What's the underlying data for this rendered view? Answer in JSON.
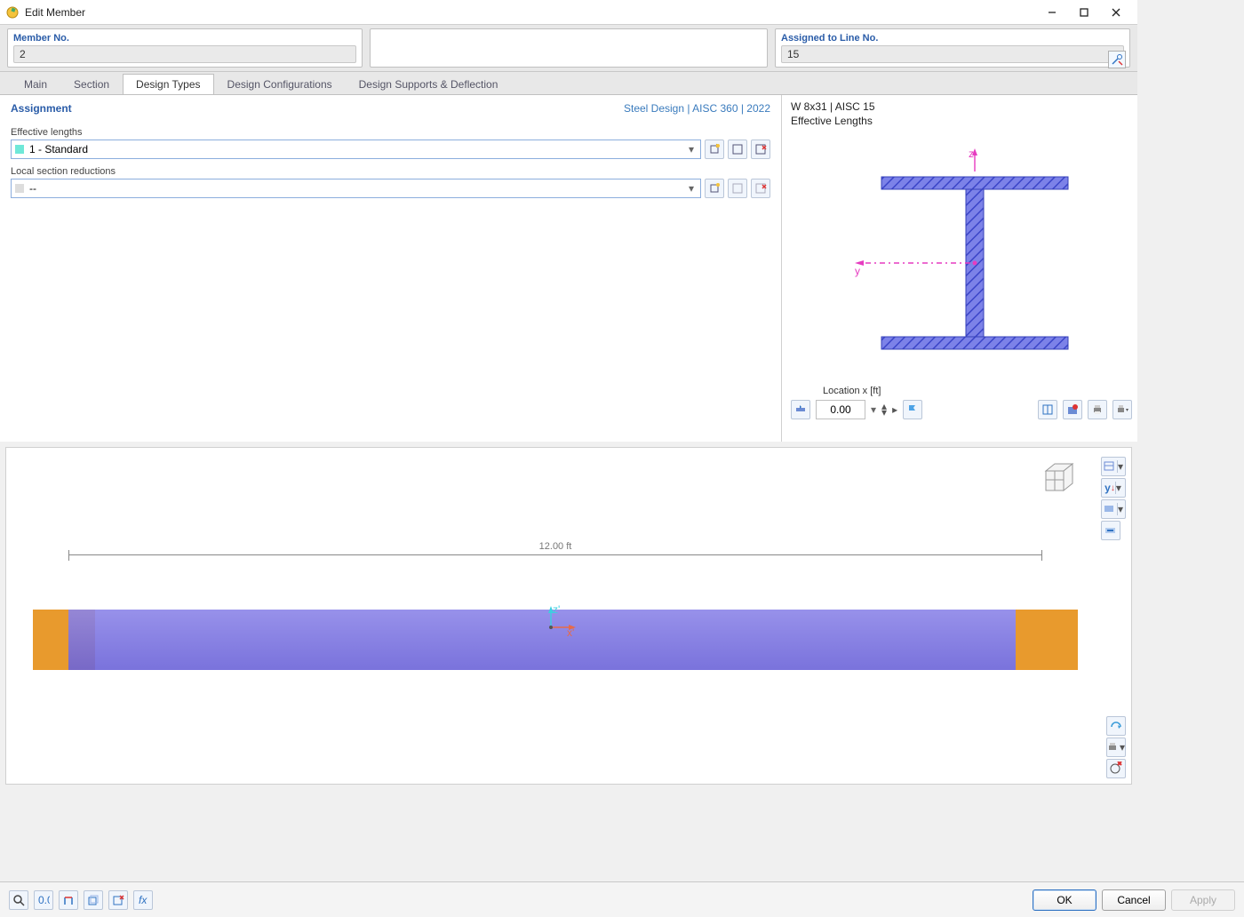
{
  "window": {
    "title": "Edit Member"
  },
  "header": {
    "member_no_label": "Member No.",
    "member_no_value": "2",
    "assigned_label": "Assigned to Line No.",
    "assigned_value": "15"
  },
  "tabs": [
    {
      "label": "Main",
      "active": false
    },
    {
      "label": "Section",
      "active": false
    },
    {
      "label": "Design Types",
      "active": true
    },
    {
      "label": "Design Configurations",
      "active": false
    },
    {
      "label": "Design Supports & Deflection",
      "active": false
    }
  ],
  "left": {
    "assignment_title": "Assignment",
    "design_standard": "Steel Design | AISC 360 | 2022",
    "eff_len_label": "Effective lengths",
    "eff_len_value": "1 - Standard",
    "local_red_label": "Local section reductions",
    "local_red_value": "--"
  },
  "preview_section": {
    "section_name": "W 8x31 | AISC 15",
    "subtitle": "Effective Lengths",
    "axis_z": "z",
    "axis_y": "y",
    "location_label": "Location x [ft]",
    "location_value": "0.00"
  },
  "preview3d": {
    "length_label": "12.00 ft",
    "axis_z": "z'",
    "axis_x": "x'"
  },
  "footer": {
    "ok": "OK",
    "cancel": "Cancel",
    "apply": "Apply"
  }
}
